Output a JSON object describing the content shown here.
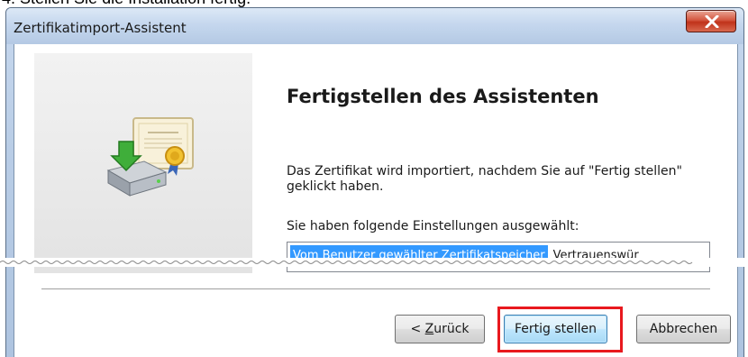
{
  "document": {
    "caption": "4. Stellen Sie die Installation fertig."
  },
  "window": {
    "title": "Zertifikatimport-Assistent",
    "close_label": "x"
  },
  "wizard": {
    "heading": "Fertigstellen des Assistenten",
    "description": "Das Zertifikat wird importiert, nachdem Sie auf \"Fertig stellen\" geklickt haben.",
    "settings_label": "Sie haben folgende Einstellungen ausgewählt:",
    "settings": [
      {
        "name": "Vom Benutzer gewählter Zertifikatspeicher",
        "value": "Vertrauenswür"
      }
    ]
  },
  "buttons": {
    "back_prefix": "< ",
    "back_accel": "Z",
    "back_rest": "urück",
    "finish_label": "Fertig stellen",
    "cancel_label": "Abbrechen"
  },
  "colors": {
    "selection": "#3399ff",
    "highlight_outline": "#e8191e",
    "close_button": "#c0321a"
  },
  "icons": {
    "wizard_graphic": "certificate-install-icon",
    "close": "close-icon"
  }
}
